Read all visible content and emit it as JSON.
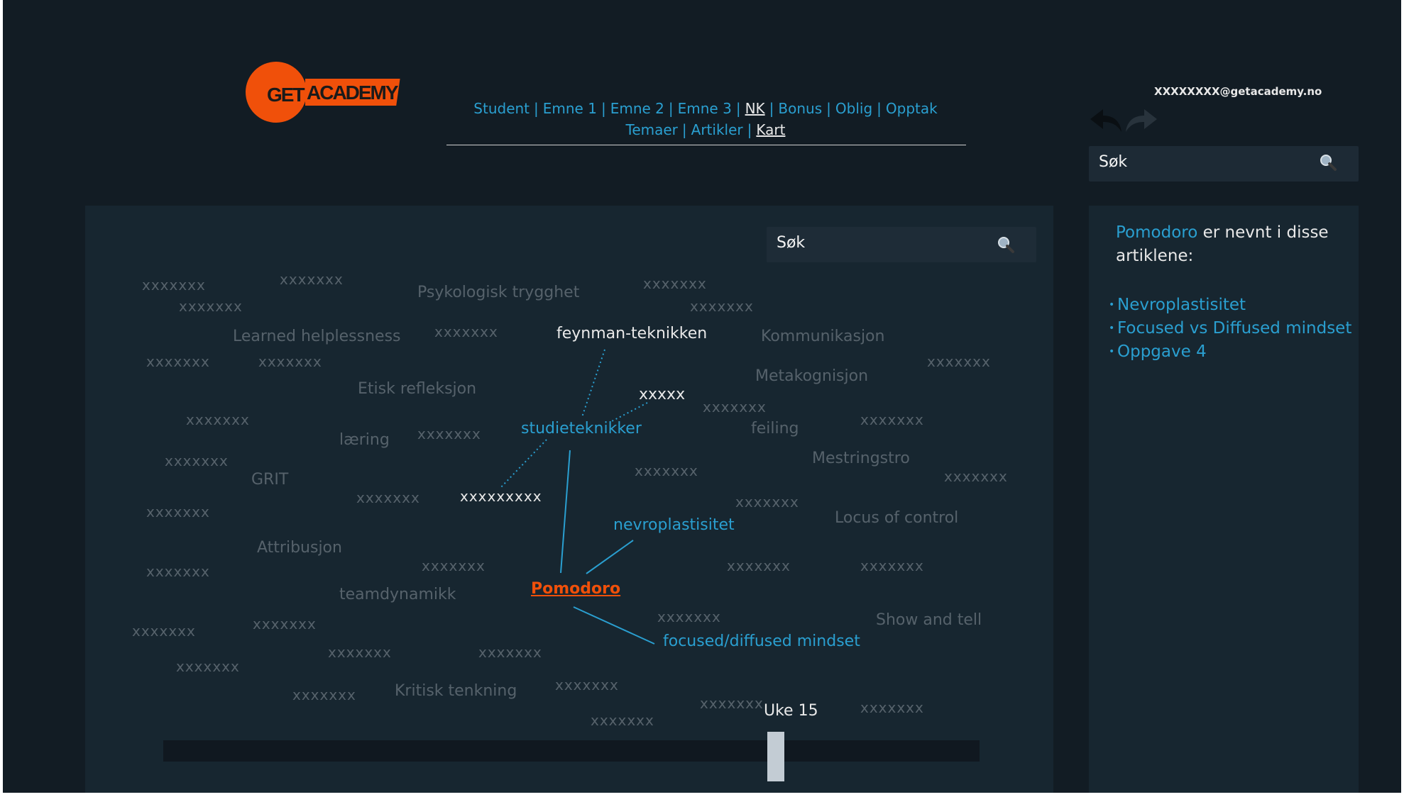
{
  "header": {
    "logo_get": "GET",
    "logo_academy": "ACADEMY",
    "user_email": "XXXXXXXX@getacademy.no",
    "search_placeholder": "Søk"
  },
  "nav": {
    "row1": [
      "Student",
      "Emne 1",
      "Emne 2",
      "Emne 3",
      "NK",
      "Bonus",
      "Oblig",
      "Opptak"
    ],
    "row2": [
      "Temaer",
      "Artikler",
      "Kart"
    ],
    "active": [
      "NK",
      "Kart"
    ]
  },
  "map": {
    "search_placeholder": "Søk",
    "focus": "Pomodoro",
    "words": {
      "psykologisk": "Psykologisk trygghet",
      "learned": "Learned helplessness",
      "feynman": "feynman-teknikken",
      "kommunikasjon": "Kommunikasjon",
      "metakognisjon": "Metakognisjon",
      "etisk": "Etisk refleksjon",
      "xxxxx": "xxxxx",
      "studieteknikker": "studieteknikker",
      "laering": "læring",
      "feiling": "feiling",
      "mestringstro": "Mestringstro",
      "grit": "GRIT",
      "xxxxxxxxx": "xxxxxxxxx",
      "nevroplastisitet": "nevroplastisitet",
      "locus": "Locus of control",
      "attribusjon": "Attribusjon",
      "teamdynamikk": "teamdynamikk",
      "focused": "focused/diffused mindset",
      "show": "Show and tell",
      "kritisk": "Kritisk tenkning"
    },
    "placeholder_word": "xxxxxxx",
    "week_label": "Uke 15",
    "timeline_position": 0.75
  },
  "side_panel": {
    "term": "Pomodoro",
    "text": " er nevnt i disse artiklene:",
    "articles": [
      "Nevroplastisitet",
      "Focused vs Diffused mindset",
      "Oppgave 4"
    ]
  },
  "colors": {
    "background": "#121c24",
    "panel": "#172630",
    "accent_blue": "#2a9fd0",
    "brand_orange": "#f0500a",
    "muted_text": "#56626b"
  }
}
